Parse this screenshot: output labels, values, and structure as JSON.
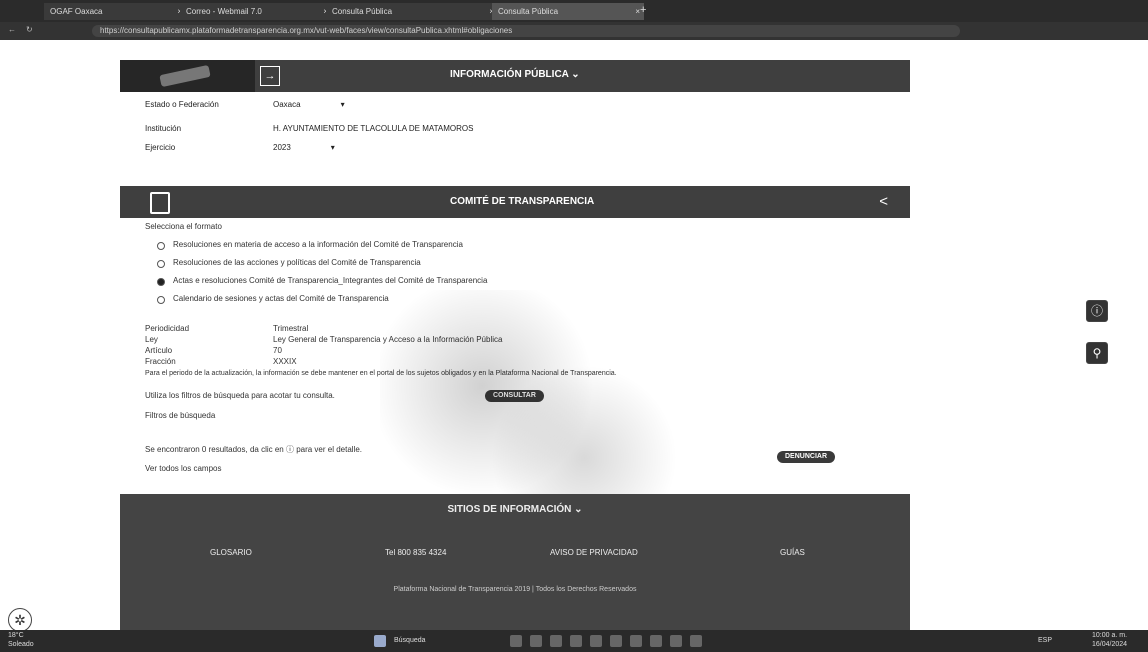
{
  "browser": {
    "tabs": [
      {
        "label": "OGAF Oaxaca"
      },
      {
        "label": "Correo - Webmail 7.0"
      },
      {
        "label": "Consulta Pública"
      },
      {
        "label": "Consulta Pública"
      }
    ],
    "new_tab": "+",
    "url": "https://consultapublicamx.plataformadetransparencia.org.mx/vut-web/faces/view/consultaPublica.xhtml#obligaciones"
  },
  "header": {
    "title": "INFORMACIÓN PÚBLICA ⌄"
  },
  "filters": {
    "state_label": "Estado o Federación",
    "state_value": "Oaxaca",
    "institution_label": "Institución",
    "institution_value": "H. AYUNTAMIENTO DE TLACOLULA DE MATAMOROS",
    "year_label": "Ejercicio",
    "year_value": "2023"
  },
  "section": {
    "title": "COMITÉ DE TRANSPARENCIA"
  },
  "content": {
    "heading": "Selecciona el formato",
    "options": [
      "Resoluciones en materia de acceso a la información del Comité de Transparencia",
      "Resoluciones de las acciones y políticas del Comité de Transparencia",
      "Actas e resoluciones Comité de Transparencia_Integrantes del Comité de Transparencia",
      "Calendario de sesiones y actas del Comité de Transparencia"
    ],
    "details": [
      {
        "label": "Periodicidad",
        "value": "Trimestral"
      },
      {
        "label": "Ley",
        "value": "Ley General de Transparencia y Acceso a la Información Pública"
      },
      {
        "label": "Artículo",
        "value": "70"
      },
      {
        "label": "Fracción",
        "value": "XXXIX"
      }
    ],
    "note": "Para el periodo de la actualización, la información se debe mantener en el portal de los sujetos obligados y en la Plataforma Nacional de Transparencia.",
    "filter_prompt": "Utiliza los filtros de búsqueda para acotar tu consulta.",
    "consult_button": "CONSULTAR",
    "search_link": "Filtros de búsqueda",
    "results_note": "Se encontraron 0 resultados, da clic en ⓘ para ver el detalle.",
    "all_fields": "Ver todos los campos",
    "denounce_button": "DENUNCIAR"
  },
  "footer": {
    "title": "SITIOS DE INFORMACIÓN ⌄",
    "glossary": "GLOSARIO",
    "phone": "Tel 800 835 4324",
    "privacy": "AVISO DE PRIVACIDAD",
    "guide": "GUÍAS",
    "copyright": "Plataforma Nacional de Transparencia 2019 | Todos los Derechos Reservados"
  },
  "taskbar": {
    "weather_temp": "18°C",
    "weather_desc": "Soleado",
    "search": "Búsqueda",
    "lang": "ESP",
    "time": "10:00 a. m.",
    "date": "16/04/2024"
  }
}
